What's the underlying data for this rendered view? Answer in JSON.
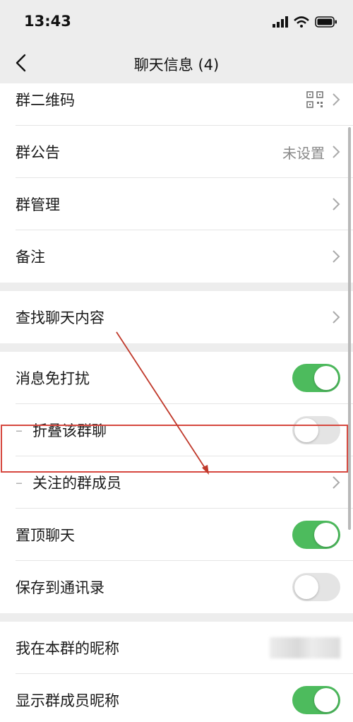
{
  "status_bar": {
    "time": "13:43"
  },
  "nav": {
    "title": "聊天信息 (4)"
  },
  "rows": {
    "qrcode": {
      "label": "群二维码"
    },
    "notice": {
      "label": "群公告",
      "value": "未设置"
    },
    "manage": {
      "label": "群管理"
    },
    "remark": {
      "label": "备注"
    },
    "search": {
      "label": "查找聊天内容"
    },
    "mute": {
      "label": "消息免打扰",
      "on": true
    },
    "fold": {
      "prefix": "–",
      "label": "折叠该群聊",
      "on": false
    },
    "follow": {
      "prefix": "–",
      "label": "关注的群成员"
    },
    "pin": {
      "label": "置顶聊天",
      "on": true
    },
    "save_contacts": {
      "label": "保存到通讯录",
      "on": false
    },
    "my_nickname": {
      "label": "我在本群的昵称"
    },
    "show_nicknames": {
      "label": "显示群成员昵称",
      "on": true
    }
  },
  "colors": {
    "toggle_on": "#4dbb5d",
    "highlight": "#d6483f",
    "annotation_arrow": "#c0392b"
  }
}
